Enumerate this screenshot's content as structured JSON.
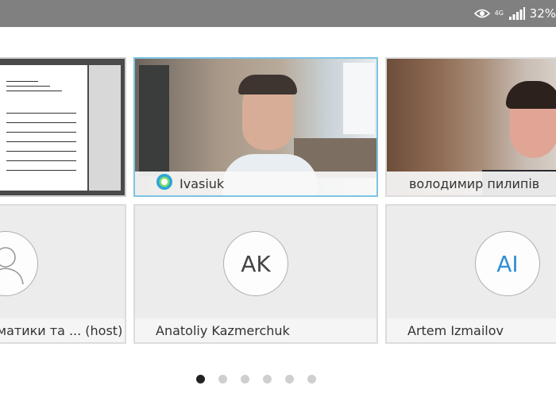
{
  "status_bar": {
    "network": "4G",
    "battery": "32%",
    "icons": [
      "eye-icon",
      "signal-icon"
    ]
  },
  "tiles": [
    {
      "name": "",
      "type": "screen-share"
    },
    {
      "name": "Ivasiuk",
      "type": "video",
      "badge_icon": "webex-icon"
    },
    {
      "name": "володимир пилипів",
      "type": "video"
    },
    {
      "name": "матики та ... (host)",
      "type": "avatar",
      "avatar_icon": "person-silhouette-icon"
    },
    {
      "name": "Anatoliy Kazmerchuk",
      "type": "avatar",
      "initials": "AK"
    },
    {
      "name": "Artem Izmailov",
      "type": "avatar",
      "initials": "AI"
    }
  ],
  "pagination": {
    "pages": 6,
    "current": 1
  },
  "colors": {
    "active_border": "#7ec3e3",
    "initials_blue": "#2f8fd6",
    "status_bar": "#808080"
  }
}
